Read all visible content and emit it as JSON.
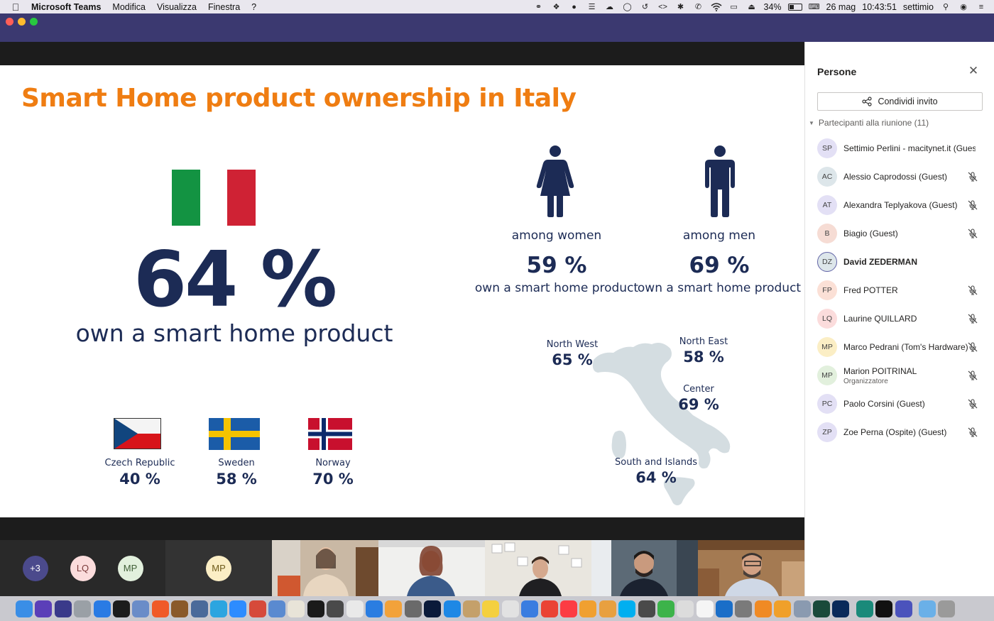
{
  "menubar": {
    "app": "Microsoft Teams",
    "menus": [
      "Modifica",
      "Visualizza",
      "Finestra",
      "?"
    ],
    "battery": "34%",
    "date": "26 mag",
    "time": "10:43:51",
    "user": "settimio"
  },
  "slide": {
    "title": "Smart Home product ownership in Italy",
    "main_pct": "64 %",
    "main_caption": "own a smart home product",
    "women": {
      "label": "among women",
      "pct": "59 %",
      "caption": "own a smart home product"
    },
    "men": {
      "label": "among men",
      "pct": "69 %",
      "caption": "own a smart home product"
    },
    "countries": [
      {
        "name": "Czech Republic",
        "pct": "40 %"
      },
      {
        "name": "Sweden",
        "pct": "58 %"
      },
      {
        "name": "Norway",
        "pct": "70 %"
      }
    ],
    "regions": [
      {
        "name": "North West",
        "pct": "65 %"
      },
      {
        "name": "North East",
        "pct": "58 %"
      },
      {
        "name": "Center",
        "pct": "69 %"
      },
      {
        "name": "South and Islands",
        "pct": "64 %"
      }
    ],
    "colors": {
      "title": "#ef7d12",
      "text": "#1c2b55",
      "map": "#d4dde1"
    }
  },
  "strip": {
    "more": "+3",
    "avatars": [
      "LQ",
      "MP"
    ],
    "tile_mp": "MP"
  },
  "panel": {
    "title": "Persone",
    "invite": "Condividi invito",
    "section": "Partecipanti alla riunione (11)",
    "people": [
      {
        "initials": "SP",
        "name": "Settimio Perlini - macitynet.it (Guest)",
        "sub": "",
        "muted": false,
        "bold": false,
        "color": "#e3e0f5"
      },
      {
        "initials": "AC",
        "name": "Alessio Caprodossi (Guest)",
        "sub": "",
        "muted": true,
        "bold": false,
        "color": "#dde6ea"
      },
      {
        "initials": "AT",
        "name": "Alexandra Teplyakova (Guest)",
        "sub": "",
        "muted": true,
        "bold": false,
        "color": "#e3e0f5"
      },
      {
        "initials": "B",
        "name": "Biagio (Guest)",
        "sub": "",
        "muted": true,
        "bold": false,
        "color": "#f6dcd4"
      },
      {
        "initials": "DZ",
        "name": "David ZEDERMAN",
        "sub": "",
        "muted": false,
        "bold": true,
        "color": "#dde6ea"
      },
      {
        "initials": "FP",
        "name": "Fred POTTER",
        "sub": "",
        "muted": true,
        "bold": false,
        "color": "#fbe0d6"
      },
      {
        "initials": "LQ",
        "name": "Laurine QUILLARD",
        "sub": "",
        "muted": true,
        "bold": false,
        "color": "#fbdcdc"
      },
      {
        "initials": "MP",
        "name": "Marco Pedrani (Tom's Hardware)",
        "sub": "",
        "muted": true,
        "bold": false,
        "color": "#fbeec5"
      },
      {
        "initials": "MP",
        "name": "Marion POITRINAL",
        "sub": "Organizzatore",
        "muted": true,
        "bold": false,
        "color": "#e2f0dd"
      },
      {
        "initials": "PC",
        "name": "Paolo Corsini (Guest)",
        "sub": "",
        "muted": true,
        "bold": false,
        "color": "#e3e0f5"
      },
      {
        "initials": "ZP",
        "name": "Zoe Perna (Ospite) (Guest)",
        "sub": "",
        "muted": true,
        "bold": false,
        "color": "#e3e0f5"
      }
    ]
  }
}
